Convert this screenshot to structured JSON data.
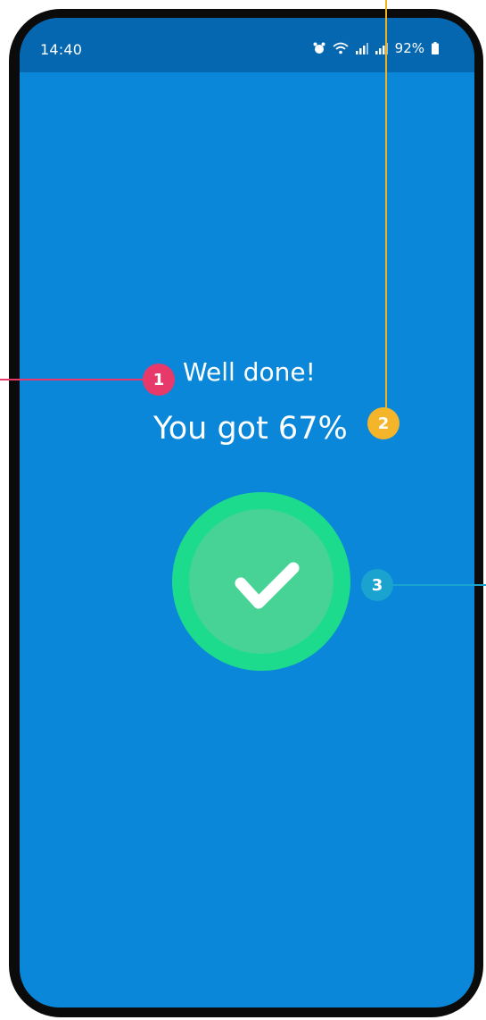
{
  "status_bar": {
    "time": "14:40",
    "icons": [
      "alarm-icon",
      "wifi-icon",
      "signal-icon",
      "signal-icon",
      "battery-icon"
    ],
    "battery": "92%"
  },
  "result": {
    "title": "Well done!",
    "score_text": "You got 67%",
    "icon": "checkmark-icon"
  },
  "annotations": [
    "1",
    "2",
    "3"
  ],
  "colors": {
    "background": "#0a87d8",
    "status_bar": "#0467b0",
    "check_outer": "#1ddb8c",
    "check_inner": "#46d395",
    "marker_1": "#e83a6a",
    "marker_2": "#f5b52a",
    "marker_3": "#1aa3cf"
  }
}
